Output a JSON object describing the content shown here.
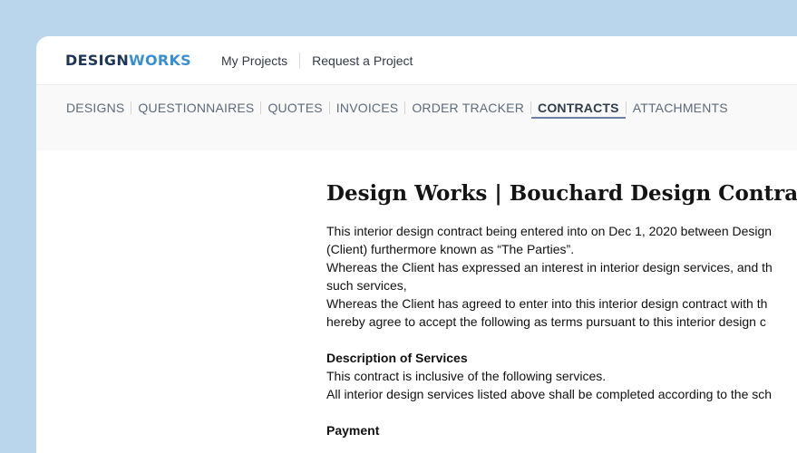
{
  "brand": {
    "part1": "DESIGN",
    "part2": "WORKS"
  },
  "topnav": {
    "items": [
      "My Projects",
      "Request a Project"
    ]
  },
  "subnav": {
    "tabs": [
      "DESIGNS",
      "QUESTIONNAIRES",
      "QUOTES",
      "INVOICES",
      "ORDER TRACKER",
      "CONTRACTS",
      "ATTACHMENTS"
    ],
    "active": "CONTRACTS"
  },
  "contract": {
    "title": "Design Works | Bouchard Design Contract",
    "intro_lines": [
      "This interior design contract being entered into on Dec 1, 2020 between Design",
      "(Client) furthermore known as “The Parties”.",
      "Whereas the Client has expressed an interest in interior design services, and th",
      "such services,",
      "Whereas the Client has agreed to enter into this interior design contract with th",
      "hereby agree to accept the following as terms pursuant to this interior design c"
    ],
    "services_heading": "Description of Services",
    "services_lines": [
      "This contract is inclusive of the following services.",
      "All interior design services listed above shall be completed according to the sch"
    ],
    "payment_heading": "Payment"
  },
  "colors": {
    "background": "#bad6ec",
    "brand_dark": "#1d3557",
    "brand_light": "#3a8fd0"
  }
}
